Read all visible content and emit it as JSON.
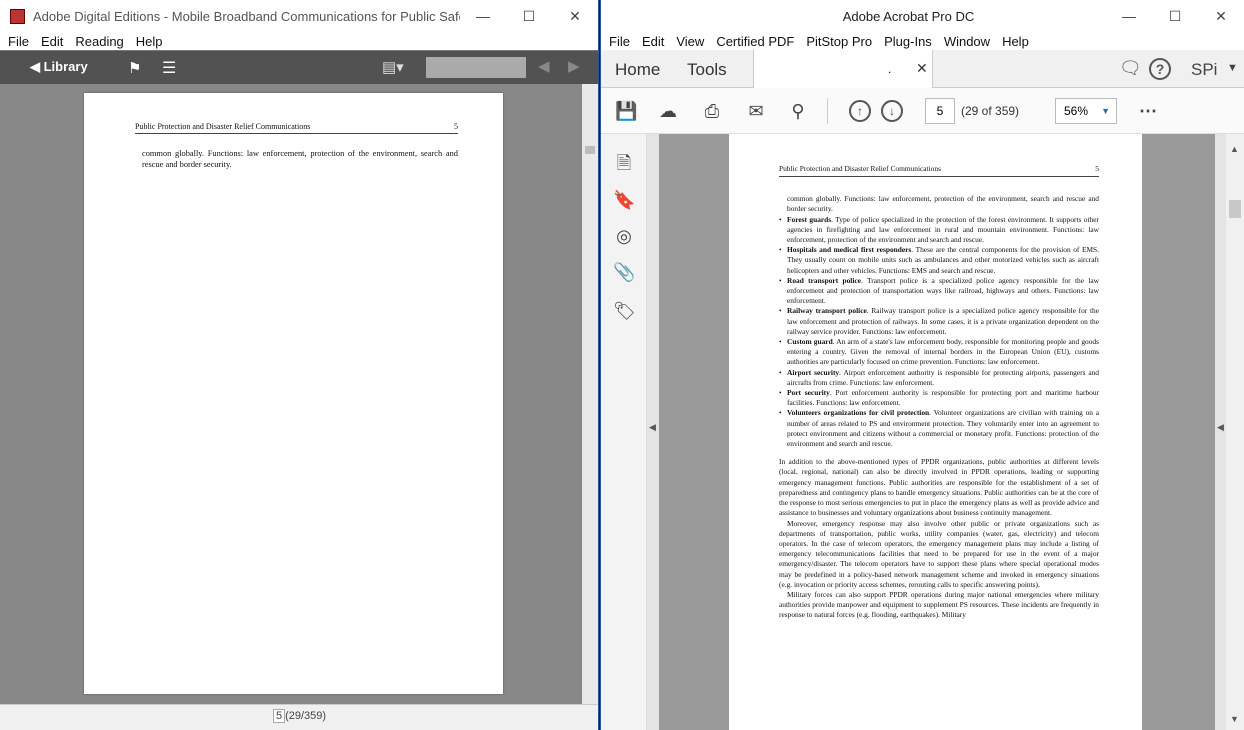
{
  "ade": {
    "title": "Adobe Digital Editions - Mobile Broadband Communications for Public Safety: ...",
    "menu": [
      "File",
      "Edit",
      "Reading",
      "Help"
    ],
    "library_label": "◀ Library",
    "page_header_left": "Public Protection and Disaster Relief Communications",
    "page_header_right": "5",
    "page_text": "common globally. Functions: law enforcement, protection of the environment, search and rescue and border security.",
    "status_page": "5",
    "status_total": "(29/359)"
  },
  "acrobat": {
    "title": "Adobe Acrobat Pro DC",
    "menu": [
      "File",
      "Edit",
      "View",
      "Certified PDF",
      "PitStop Pro",
      "Plug-Ins",
      "Window",
      "Help"
    ],
    "tab_home": "Home",
    "tab_tools": "Tools",
    "tab_doc": ".",
    "user": "SPi",
    "page_number": "5",
    "page_count": "(29 of 359)",
    "zoom": "56%",
    "page_header_left": "Public Protection and Disaster Relief Communications",
    "page_header_right": "5",
    "lead": "common globally. Functions: law enforcement, protection of the environment, search and rescue and border security.",
    "bullets": [
      {
        "term": "Forest guards",
        "text": ". Type of police specialized in the protection of the forest environment. It supports other agencies in firefighting and law enforcement in rural and mountain environment. Functions: law enforcement, protection of the environment and search and rescue."
      },
      {
        "term": "Hospitals and medical first responders",
        "text": ". These are the central components for the provision of EMS. They usually count on mobile units such as ambulances and other motorized vehicles such as aircraft helicopters and other vehicles. Functions: EMS and search and rescue."
      },
      {
        "term": "Road transport police",
        "text": ". Transport police is a specialized police agency responsible for the law enforcement and protection of transportation ways like railroad, highways and others. Functions: law enforcement."
      },
      {
        "term": "Railway transport police",
        "text": ". Railway transport police is a specialized police agency responsible for the law enforcement and protection of railways. In some cases, it is a private organization dependent on the railway service provider. Functions: law enforcement."
      },
      {
        "term": "Custom guard",
        "text": ". An arm of a state's law enforcement body, responsible for monitoring people and goods entering a country. Given the removal of internal borders in the European Union (EU), customs authorities are particularly focused on crime prevention. Functions: law enforcement."
      },
      {
        "term": "Airport security",
        "text": ". Airport enforcement authority is responsible for protecting airports, passengers and aircrafts from crime. Functions: law enforcement."
      },
      {
        "term": "Port security",
        "text": ". Port enforcement authority is responsible for protecting port and maritime harbour facilities. Functions: law enforcement."
      },
      {
        "term": "Volunteers organizations for civil protection",
        "text": ". Volunteer organizations are civilian with training on a number of areas related to PS and environment protection. They voluntarily enter into an agreement to protect environment and citizens without a commercial or monetary profit. Functions: protection of the environment and search and rescue."
      }
    ],
    "para1": "In addition to the above-mentioned types of PPDR organizations, public authorities at different levels (local, regional, national) can also be directly involved in PPDR operations, leading or supporting emergency management functions. Public authorities are responsible for the establishment of a set of preparedness and contingency plans to handle emergency situations. Public authorities can be at the core of the response to most serious emergencies to put in place the emergency plans as well as provide advice and assistance to businesses and voluntary organizations about business continuity management.",
    "para2": "Moreover, emergency response may also involve other public or private organizations such as departments of transportation, public works, utility companies (water, gas, electricity) and telecom operators. In the case of telecom operators, the emergency management plans may include a listing of emergency telecommunications facilities that need to be prepared for use in the event of a major emergency/disaster. The telecom operators have to support these plans where special operational modes may be predefined in a policy-based network management scheme and invoked in emergency situations (e.g. invocation or priority access schemes, rerouting calls to specific answering points).",
    "para3": "Military forces can also support PPDR operations during major national emergencies where military authorities provide manpower and equipment to supplement PS resources. These incidents are frequently in response to natural forces (e.g. flooding, earthquakes). Military"
  }
}
